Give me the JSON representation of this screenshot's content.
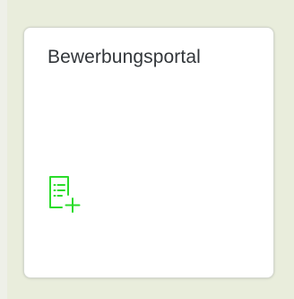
{
  "tile": {
    "title": "Bewerbungsportal",
    "icon": "document-add-icon",
    "icon_color": "#2bdc2b"
  },
  "colors": {
    "page_background": "#e9eddc",
    "tile_background": "#ffffff",
    "title_text": "#32363a"
  }
}
